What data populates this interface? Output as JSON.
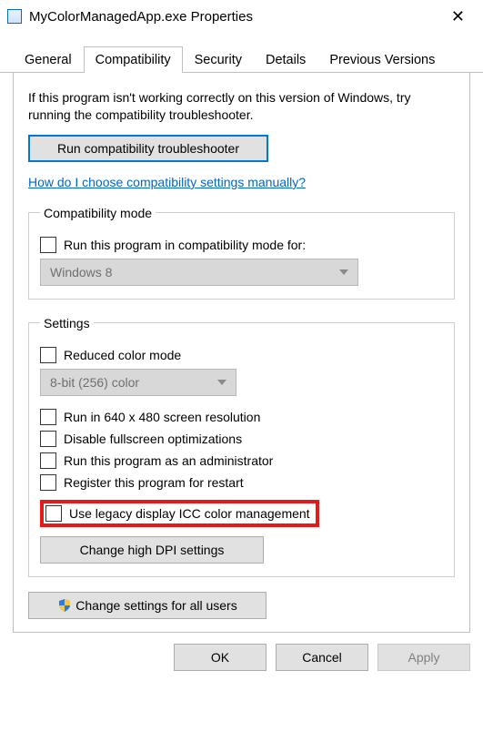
{
  "window_title": "MyColorManagedApp.exe Properties",
  "tabs": {
    "general": "General",
    "compatibility": "Compatibility",
    "security": "Security",
    "details": "Details",
    "previous": "Previous Versions"
  },
  "intro": "If this program isn't working correctly on this version of Windows, try running the compatibility troubleshooter.",
  "run_troubleshooter": "Run compatibility troubleshooter",
  "manual_link": "How do I choose compatibility settings manually?",
  "compat_mode": {
    "legend": "Compatibility mode",
    "checkbox": "Run this program in compatibility mode for:",
    "selected": "Windows 8"
  },
  "settings": {
    "legend": "Settings",
    "reduced_color": "Reduced color mode",
    "color_selected": "8-bit (256) color",
    "run_640": "Run in 640 x 480 screen resolution",
    "disable_fullscreen": "Disable fullscreen optimizations",
    "run_admin": "Run this program as an administrator",
    "register_restart": "Register this program for restart",
    "legacy_icc": "Use legacy display ICC color management",
    "change_dpi": "Change high DPI settings"
  },
  "change_all_users": "Change settings for all users",
  "footer": {
    "ok": "OK",
    "cancel": "Cancel",
    "apply": "Apply"
  }
}
